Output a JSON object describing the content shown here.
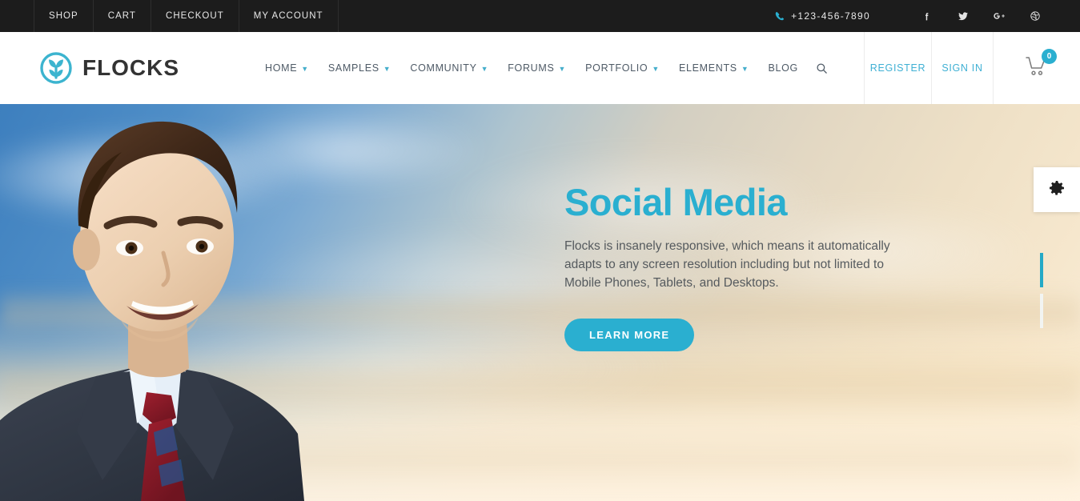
{
  "topbar": {
    "links": [
      {
        "label": "SHOP",
        "name": "topbar-link-shop"
      },
      {
        "label": "CART",
        "name": "topbar-link-cart"
      },
      {
        "label": "CHECKOUT",
        "name": "topbar-link-checkout"
      },
      {
        "label": "MY ACCOUNT",
        "name": "topbar-link-my-account"
      }
    ],
    "phone": "+123-456-7890",
    "phone_icon": "phone-icon",
    "social": [
      {
        "name": "facebook-icon",
        "label": "Facebook"
      },
      {
        "name": "twitter-icon",
        "label": "Twitter"
      },
      {
        "name": "google-plus-icon",
        "label": "Google Plus"
      },
      {
        "name": "dribbble-icon",
        "label": "Dribbble"
      }
    ]
  },
  "header": {
    "logo_text": "FLOCKS",
    "logo_icon": "flocks-logo-icon",
    "nav": [
      {
        "label": "HOME",
        "dropdown": true
      },
      {
        "label": "SAMPLES",
        "dropdown": true
      },
      {
        "label": "COMMUNITY",
        "dropdown": true
      },
      {
        "label": "FORUMS",
        "dropdown": true
      },
      {
        "label": "PORTFOLIO",
        "dropdown": true
      },
      {
        "label": "ELEMENTS",
        "dropdown": true
      },
      {
        "label": "BLOG",
        "dropdown": false
      }
    ],
    "search_icon": "search-icon",
    "register_label": "REGISTER",
    "signin_label": "SIGN IN",
    "cart_icon": "shopping-cart-icon",
    "cart_count": "0"
  },
  "hero": {
    "title": "Social Media",
    "description": "Flocks is insanely responsive, which means it automatically adapts to any screen resolution including but not limited to Mobile Phones, Tablets, and Desktops.",
    "cta_label": "LEARN MORE",
    "settings_icon": "gear-icon",
    "slides": [
      {
        "active": true
      },
      {
        "active": false
      }
    ]
  },
  "colors": {
    "accent": "#2aafd0",
    "accent_dark": "#25a9c6",
    "topbar_bg": "#1c1c1c",
    "nav_text": "#4e5a66",
    "body_text": "#555a5e"
  }
}
